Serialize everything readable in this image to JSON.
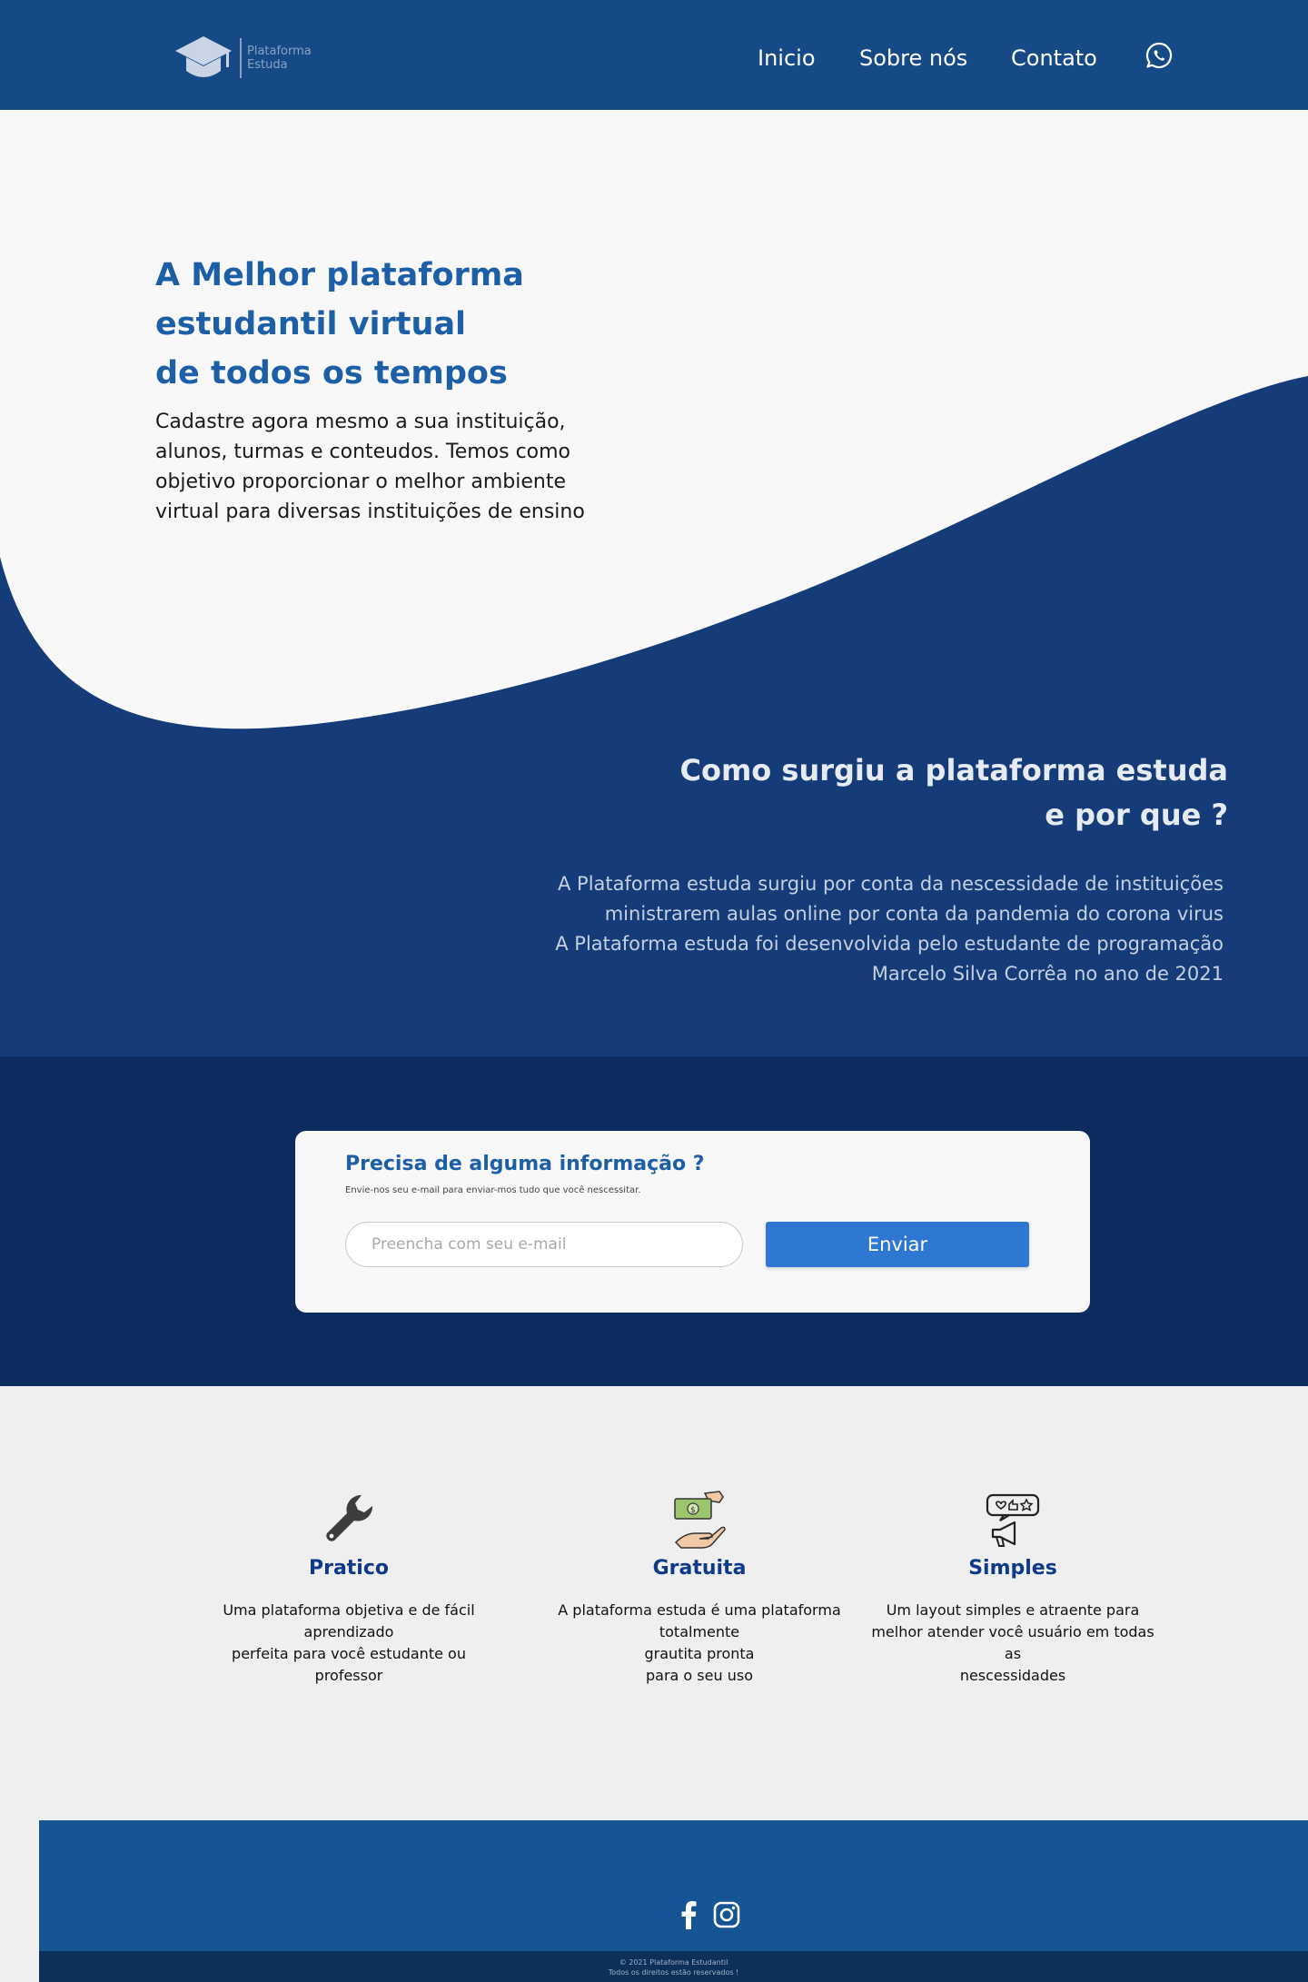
{
  "header": {
    "logo_line1": "Plataforma",
    "logo_line2": "Estuda",
    "nav": [
      "Inicio",
      "Sobre nós",
      "Contato"
    ]
  },
  "hero": {
    "title_line1": "A Melhor plataforma",
    "title_line2": "estudantil virtual",
    "title_line3": "de todos os tempos",
    "text": "Cadastre agora mesmo a sua instituição, alunos, turmas e conteudos. Temos como objetivo proporcionar o melhor ambiente virtual para diversas instituições de ensino"
  },
  "about": {
    "title_line1": "Como surgiu a plataforma estuda",
    "title_line2": "e por que ?",
    "text_line1": "A Plataforma estuda surgiu por conta da nescessidade de instituições",
    "text_line2": "ministrarem aulas online por conta da pandemia do corona virus",
    "text_line3": "A Plataforma estuda foi desenvolvida pelo estudante de programação",
    "text_line4": "Marcelo Silva Corrêa no ano de 2021"
  },
  "contact": {
    "title": "Precisa de alguma informação ?",
    "subtitle": "Envie-nos seu e-mail para enviar-mos tudo que você nescessitar.",
    "email_placeholder": "Preencha com seu e-mail",
    "email_value": "",
    "send_label": "Enviar"
  },
  "features": [
    {
      "icon": "wrench-icon",
      "title": "Pratico",
      "text": "Uma plataforma objetiva e de fácil\naprendizado\nperfeita para você estudante ou\nprofessor"
    },
    {
      "icon": "money-hand-icon",
      "title": "Gratuita",
      "text": "A plataforma estuda é uma plataforma\ntotalmente\ngrautita pronta\npara o seu uso"
    },
    {
      "icon": "feedback-megaphone-icon",
      "title": "Simples",
      "text": "Um layout simples e atraente para\nmelhor atender você usuário em todas as\nnescessidades"
    }
  ],
  "footer": {
    "copyright": "© 2021 Plataforma Estudantil",
    "rights": "Todos os direitos estão reservados !"
  },
  "colors": {
    "header_bg": "#154a87",
    "hero_dark": "#153b79",
    "accent_blue": "#1c5fa7",
    "contact_bg": "#0c2b5e",
    "button": "#2e77d3",
    "footer_bg": "#155594",
    "footer_bottom": "#0d3059"
  }
}
